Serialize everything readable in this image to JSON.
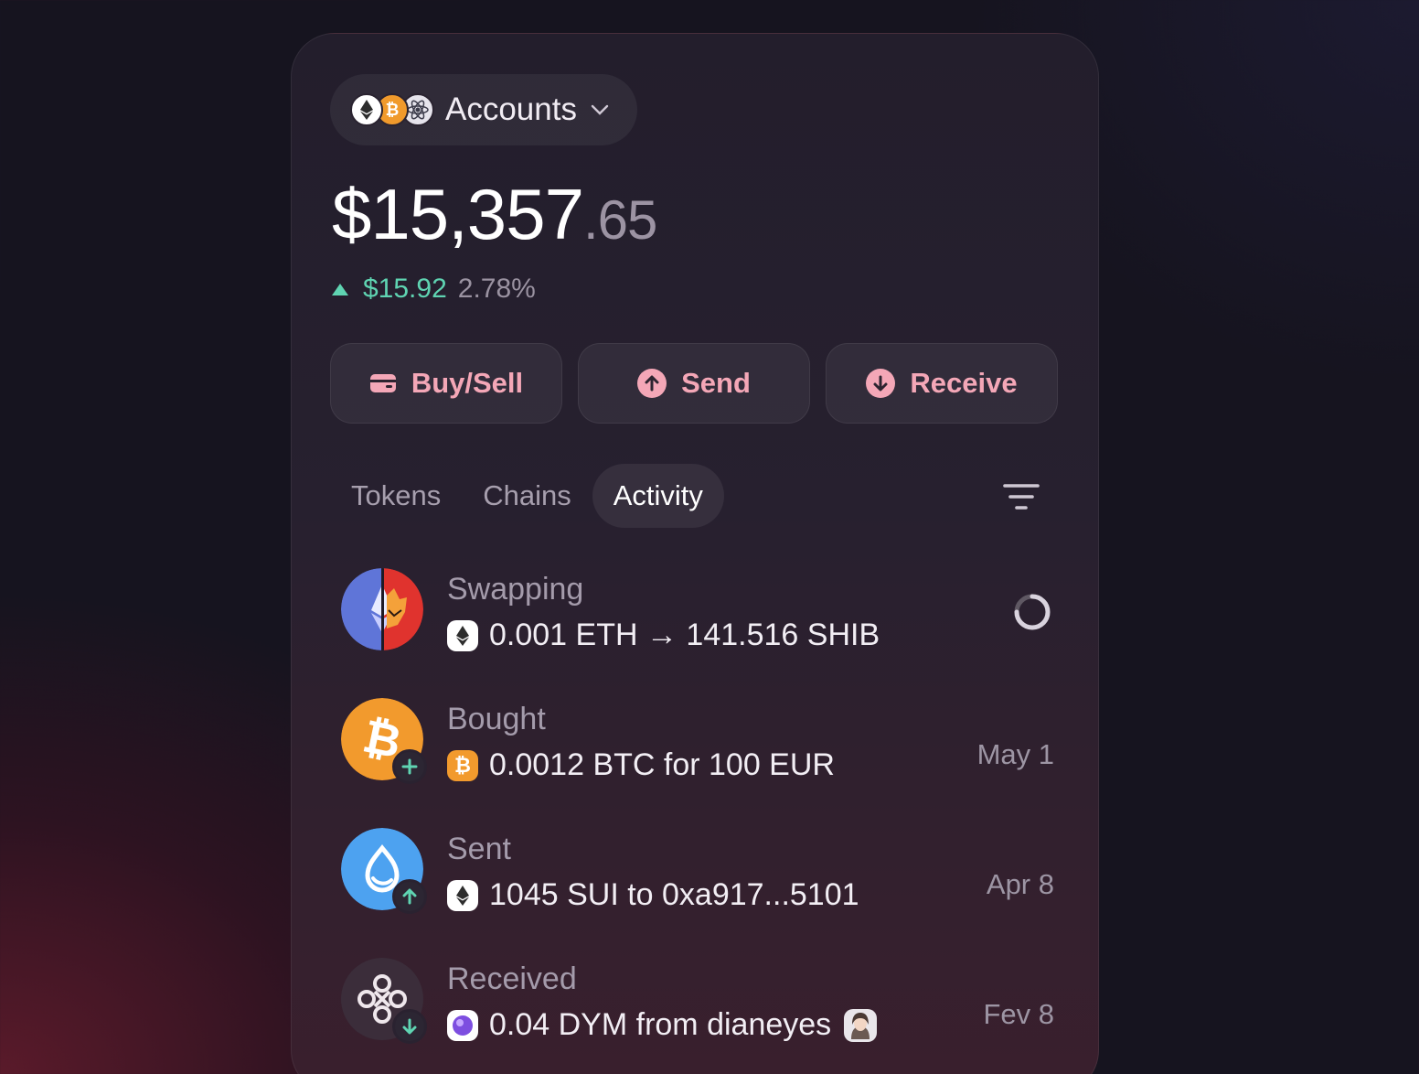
{
  "header": {
    "accounts_label": "Accounts",
    "account_coins": [
      "eth-icon",
      "btc-icon",
      "atom-icon"
    ]
  },
  "balance": {
    "whole": "$15,357",
    "cents": ".65"
  },
  "change": {
    "direction": "up",
    "amount": "$15.92",
    "percent": "2.78%"
  },
  "actions": {
    "buy_sell": "Buy/Sell",
    "send": "Send",
    "receive": "Receive"
  },
  "tabs": [
    {
      "label": "Tokens",
      "active": false
    },
    {
      "label": "Chains",
      "active": false
    },
    {
      "label": "Activity",
      "active": true
    }
  ],
  "activity": [
    {
      "title": "Swapping",
      "detail": "0.001 ETH → 141.516 SHIB",
      "date": "",
      "status": "pending",
      "token_icon": "eth-icon",
      "avatar_icon": "eth-shib-swap-icon"
    },
    {
      "title": "Bought",
      "detail": "0.0012 BTC for 100 EUR",
      "date": "May 1",
      "status": "done",
      "token_icon": "btc-icon",
      "avatar_icon": "btc-icon",
      "badge_icon": "plus-icon"
    },
    {
      "title": "Sent",
      "detail": "1045 SUI to 0xa917...5101",
      "date": "Apr 8",
      "status": "done",
      "token_icon": "eth-icon",
      "avatar_icon": "sui-icon",
      "badge_icon": "arrow-up-icon"
    },
    {
      "title": "Received",
      "detail": "0.04 DYM from dianeyes",
      "date": "Fev 8",
      "status": "done",
      "token_icon": "dym-icon",
      "avatar_icon": "dym-knot-icon",
      "badge_icon": "arrow-down-icon"
    }
  ],
  "colors": {
    "accent": "#f4a7b7",
    "positive": "#5fd4b2",
    "background": "#16141f",
    "panel": "#27202f"
  }
}
